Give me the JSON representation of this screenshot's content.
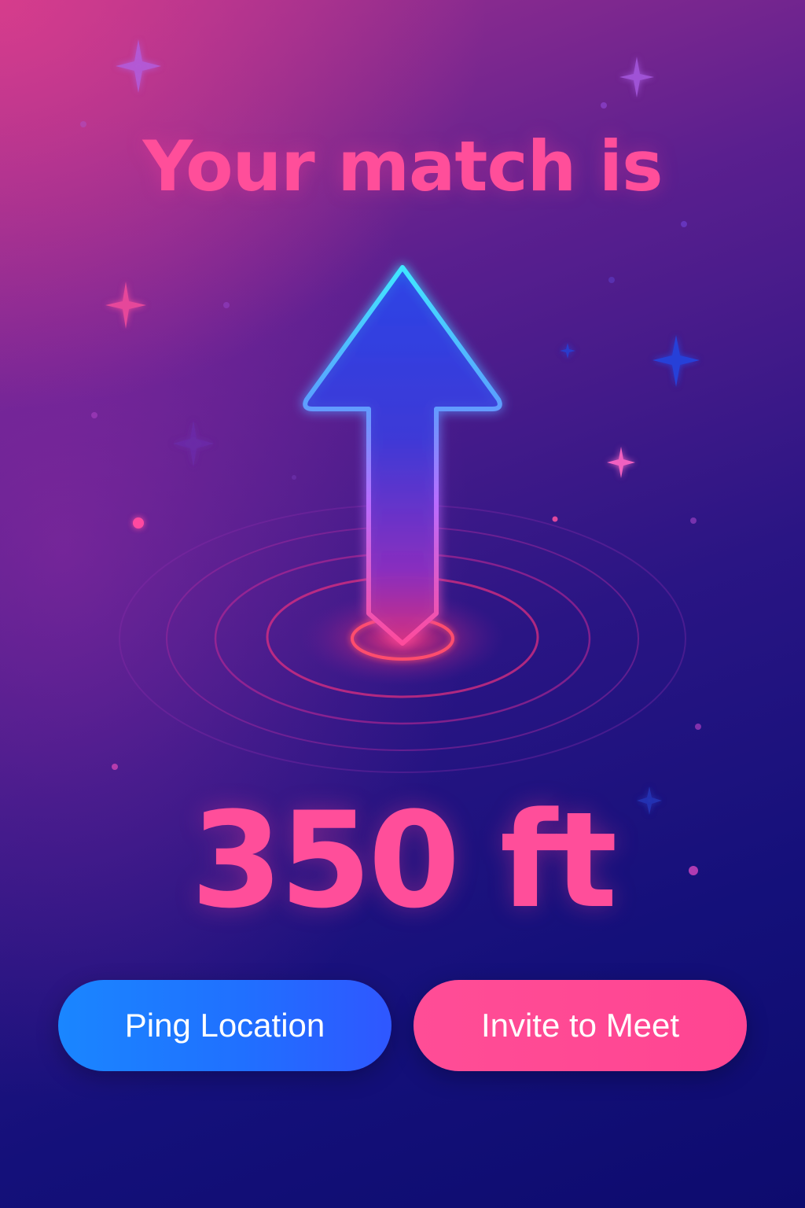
{
  "headline": "Your match is",
  "distance": "350 ft",
  "arrow_direction": "up",
  "actions": {
    "ping_label": "Ping Location",
    "invite_label": "Invite to Meet"
  },
  "colors": {
    "accent_pink": "#ff4e9a",
    "button_blue": "#1f7bff",
    "button_pink": "#ff4a95",
    "arrow_cyan": "#40e8ff",
    "background_navy": "#14107a"
  }
}
